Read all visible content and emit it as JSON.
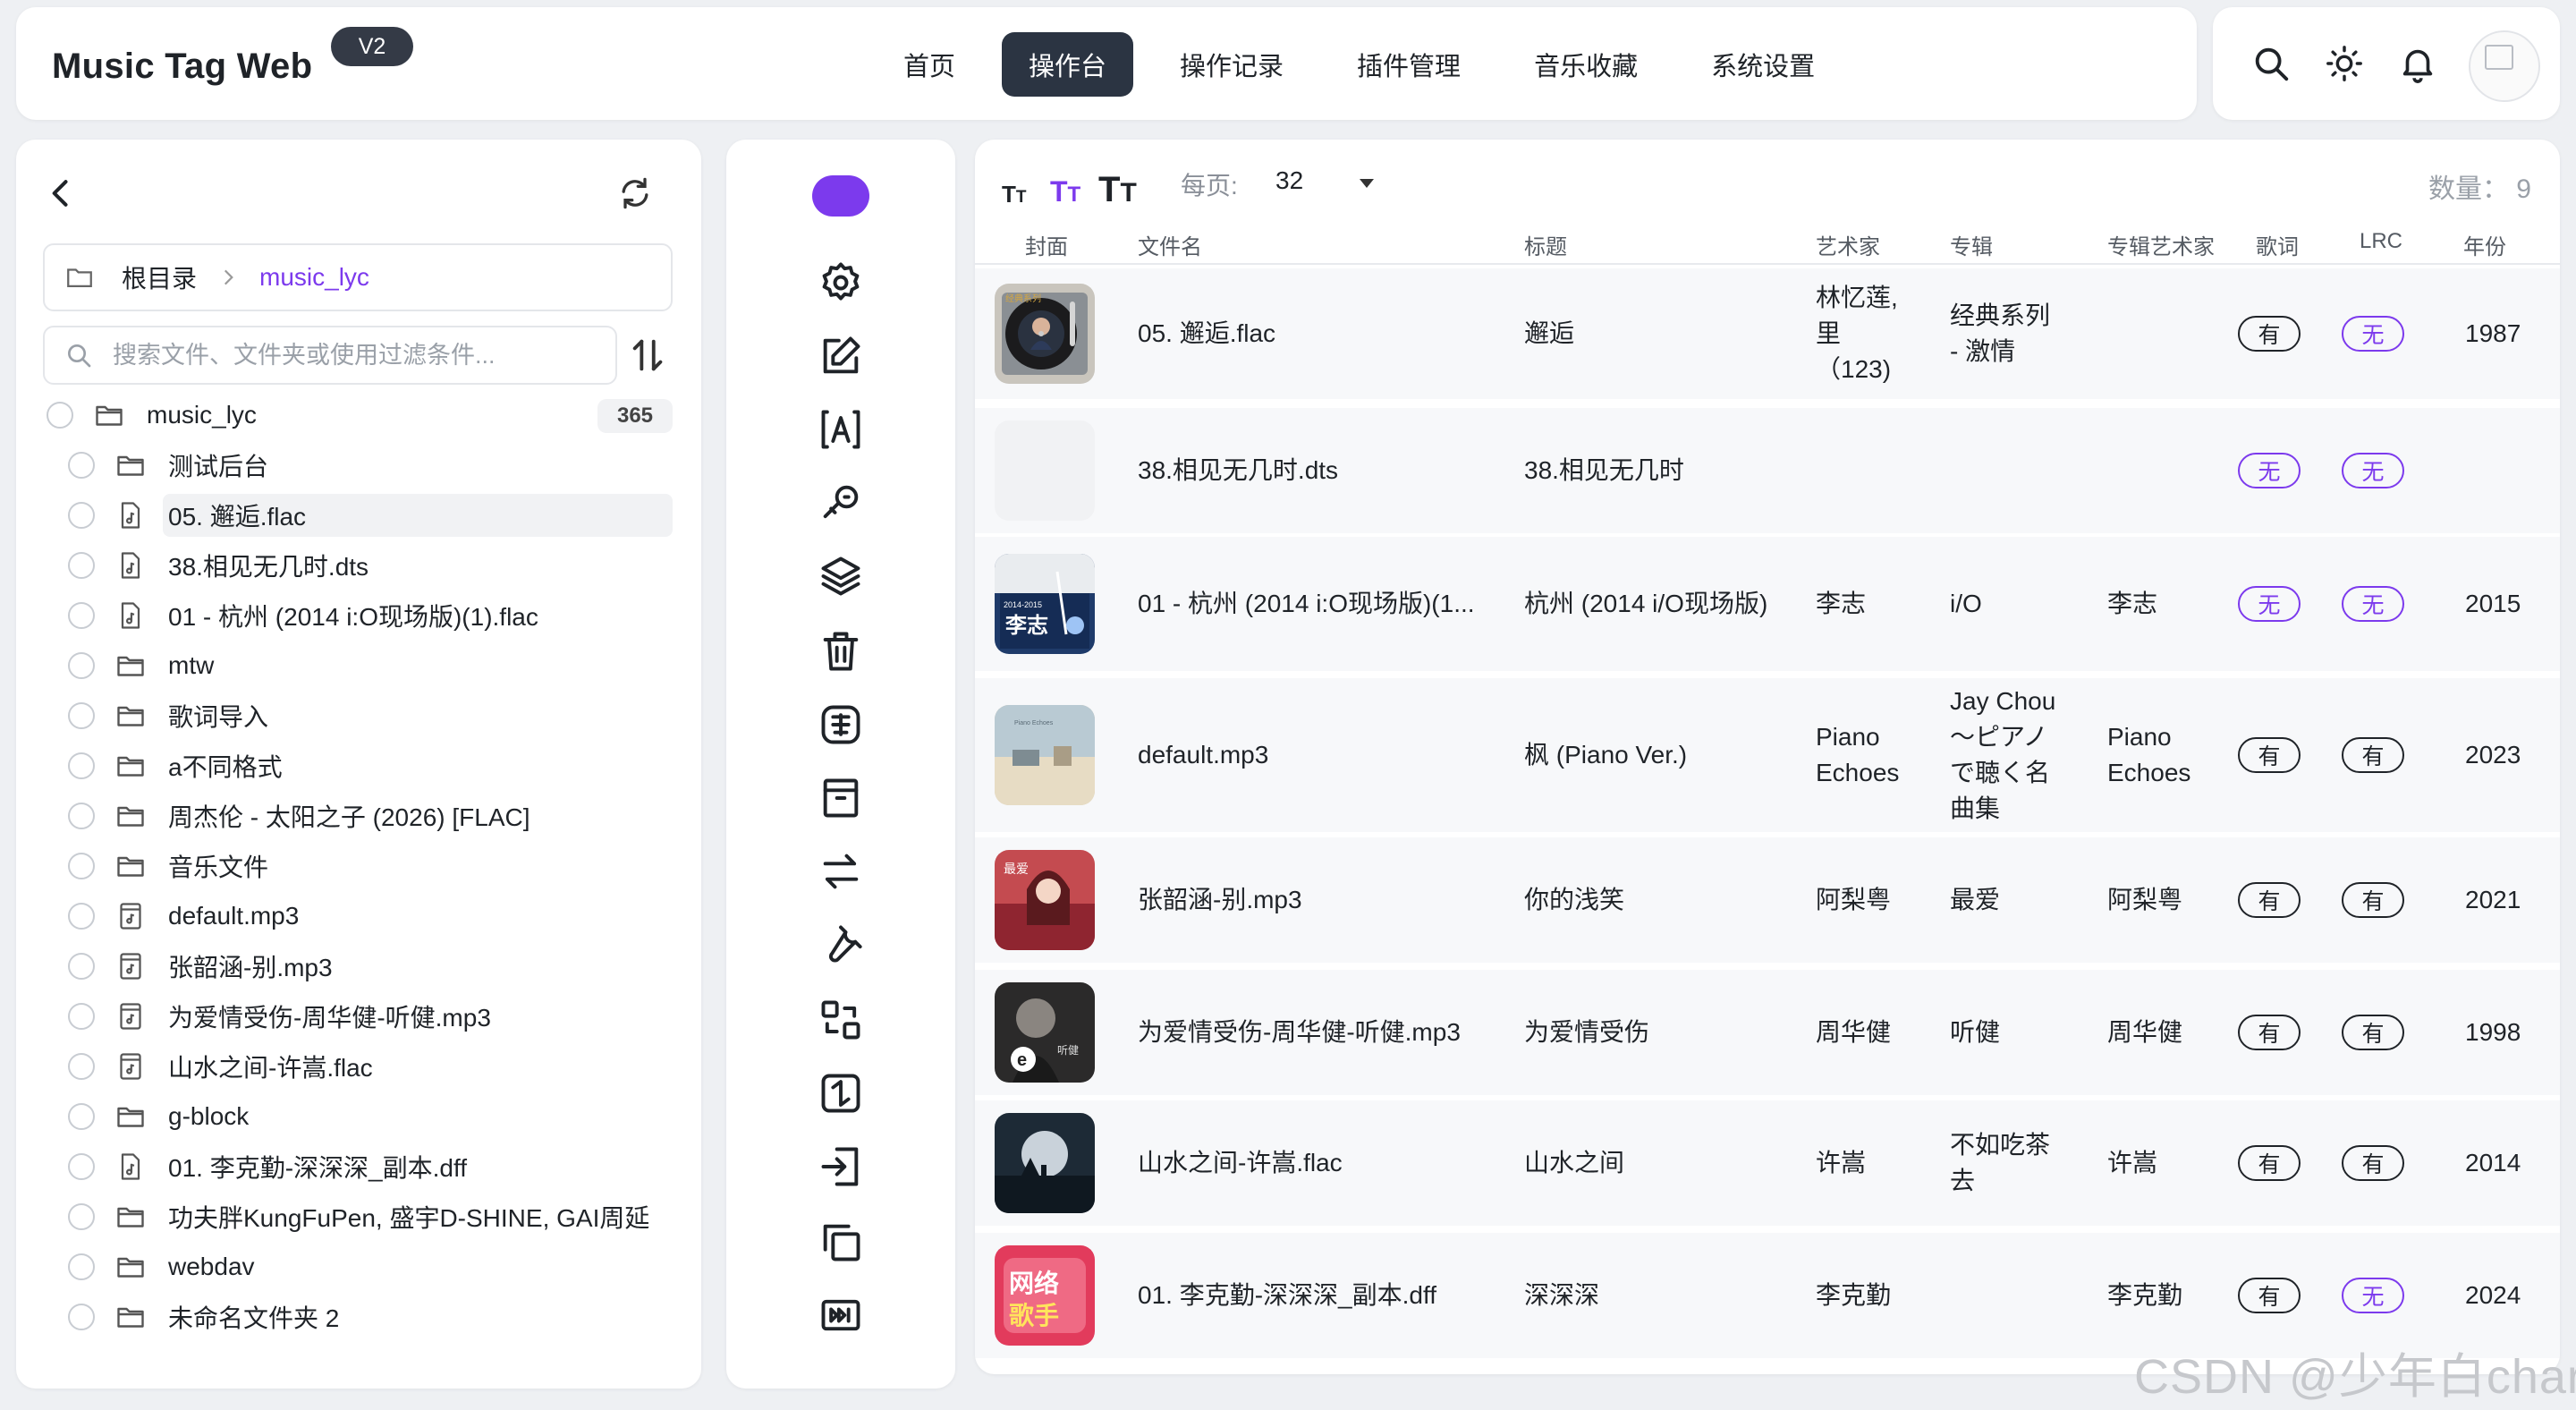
{
  "app": {
    "title": "Music Tag Web",
    "version": "V2"
  },
  "nav": [
    {
      "label": "首页",
      "active": false
    },
    {
      "label": "操作台",
      "active": true
    },
    {
      "label": "操作记录",
      "active": false
    },
    {
      "label": "插件管理",
      "active": false
    },
    {
      "label": "音乐收藏",
      "active": false
    },
    {
      "label": "系统设置",
      "active": false
    }
  ],
  "header_icons": [
    "search-icon",
    "sun-icon",
    "bell-icon",
    "avatar"
  ],
  "accent": "#7c3aed",
  "breadcrumb": {
    "root": "根目录",
    "current": "music_lyc"
  },
  "search": {
    "placeholder": "搜索文件、文件夹或使用过滤条件..."
  },
  "tree": {
    "root": {
      "name": "music_lyc",
      "count": "365"
    },
    "items": [
      {
        "name": "测试后台",
        "type": "folder"
      },
      {
        "name": "05. 邂逅.flac",
        "type": "file",
        "selected": true
      },
      {
        "name": "38.相见无几时.dts",
        "type": "file"
      },
      {
        "name": "01 - 杭州 (2014 i:O现场版)(1).flac",
        "type": "file"
      },
      {
        "name": "mtw",
        "type": "folder"
      },
      {
        "name": "歌词导入",
        "type": "folder"
      },
      {
        "name": "a不同格式",
        "type": "folder"
      },
      {
        "name": "周杰伦 - 太阳之子 (2026) [FLAC]",
        "type": "folder"
      },
      {
        "name": "音乐文件",
        "type": "folder"
      },
      {
        "name": "default.mp3",
        "type": "audio"
      },
      {
        "name": "张韶涵-别.mp3",
        "type": "audio"
      },
      {
        "name": "为爱情受伤-周华健-听健.mp3",
        "type": "audio"
      },
      {
        "name": "山水之间-许嵩.flac",
        "type": "audio"
      },
      {
        "name": "g-block",
        "type": "folder"
      },
      {
        "name": "01. 李克勤-深深深_副本.dff",
        "type": "file"
      },
      {
        "name": "功夫胖KungFuPen, 盛宇D-SHINE, GAI周延",
        "type": "folder"
      },
      {
        "name": "webdav",
        "type": "folder"
      },
      {
        "name": "未命名文件夹 2",
        "type": "folder"
      }
    ]
  },
  "tools": [
    "settings-icon",
    "edit-icon",
    "text-recognize-icon",
    "audio-fingerprint-icon",
    "layers-icon",
    "trash-icon",
    "traditional-chinese-icon",
    "archive-icon",
    "swap-icon",
    "wrench-icon",
    "convert-icon",
    "rotate-icon",
    "import-icon",
    "copy-icon",
    "fast-forward-icon"
  ],
  "table": {
    "per_page_label": "每页:",
    "per_page": "32",
    "count_label": "数量： 9",
    "yes": "有",
    "no": "无",
    "columns": [
      "封面",
      "文件名",
      "标题",
      "艺术家",
      "专辑",
      "专辑艺术家",
      "歌词",
      "LRC",
      "年份"
    ],
    "rows": [
      {
        "file": "05. 邂逅.flac",
        "title": "邂逅",
        "artist": [
          "林忆莲,",
          "里",
          "（123)"
        ],
        "album": [
          "经典系列",
          "- 激情"
        ],
        "album_artist": [],
        "lyric": "有",
        "lrc": "无",
        "year": "1987",
        "cover": "vinyl"
      },
      {
        "file": "38.相见无几时.dts",
        "title": "38.相见无几时",
        "artist": [],
        "album": [],
        "album_artist": [],
        "lyric": "无",
        "lrc": "无",
        "year": "",
        "cover": "blank"
      },
      {
        "file": "01 - 杭州 (2014 i:O现场版)(1...",
        "title": "杭州 (2014 i/O现场版)",
        "artist": [
          "李志"
        ],
        "album": [
          "i/O"
        ],
        "album_artist": [
          "李志"
        ],
        "lyric": "无",
        "lrc": "无",
        "year": "2015",
        "cover": "navy"
      },
      {
        "file": "default.mp3",
        "title": "枫 (Piano Ver.)",
        "artist": [
          "Piano",
          "Echoes"
        ],
        "album": [
          "Jay Chou",
          "～ピアノ",
          "で聴く名",
          "曲集"
        ],
        "album_artist": [
          "Piano",
          "Echoes"
        ],
        "lyric": "有",
        "lrc": "有",
        "year": "2023",
        "cover": "sky"
      },
      {
        "file": "张韶涵-别.mp3",
        "title": "你的浅笑",
        "artist": [
          "阿梨粤"
        ],
        "album": [
          "最爱"
        ],
        "album_artist": [
          "阿梨粤"
        ],
        "lyric": "有",
        "lrc": "有",
        "year": "2021",
        "cover": "pink"
      },
      {
        "file": "为爱情受伤-周华健-听健.mp3",
        "title": "为爱情受伤",
        "artist": [
          "周华健"
        ],
        "album": [
          "听健"
        ],
        "album_artist": [
          "周华健"
        ],
        "lyric": "有",
        "lrc": "有",
        "year": "1998",
        "cover": "dark"
      },
      {
        "file": "山水之间-许嵩.flac",
        "title": "山水之间",
        "artist": [
          "许嵩"
        ],
        "album": [
          "不如吃茶",
          "去"
        ],
        "album_artist": [
          "许嵩"
        ],
        "lyric": "有",
        "lrc": "有",
        "year": "2014",
        "cover": "night"
      },
      {
        "file": "01. 李克勤-深深深_副本.dff",
        "title": "深深深",
        "artist": [
          "李克勤"
        ],
        "album": [],
        "album_artist": [
          "李克勤"
        ],
        "lyric": "有",
        "lrc": "无",
        "year": "2024",
        "cover": "red"
      }
    ]
  },
  "watermark": "CSDN @少年白char"
}
